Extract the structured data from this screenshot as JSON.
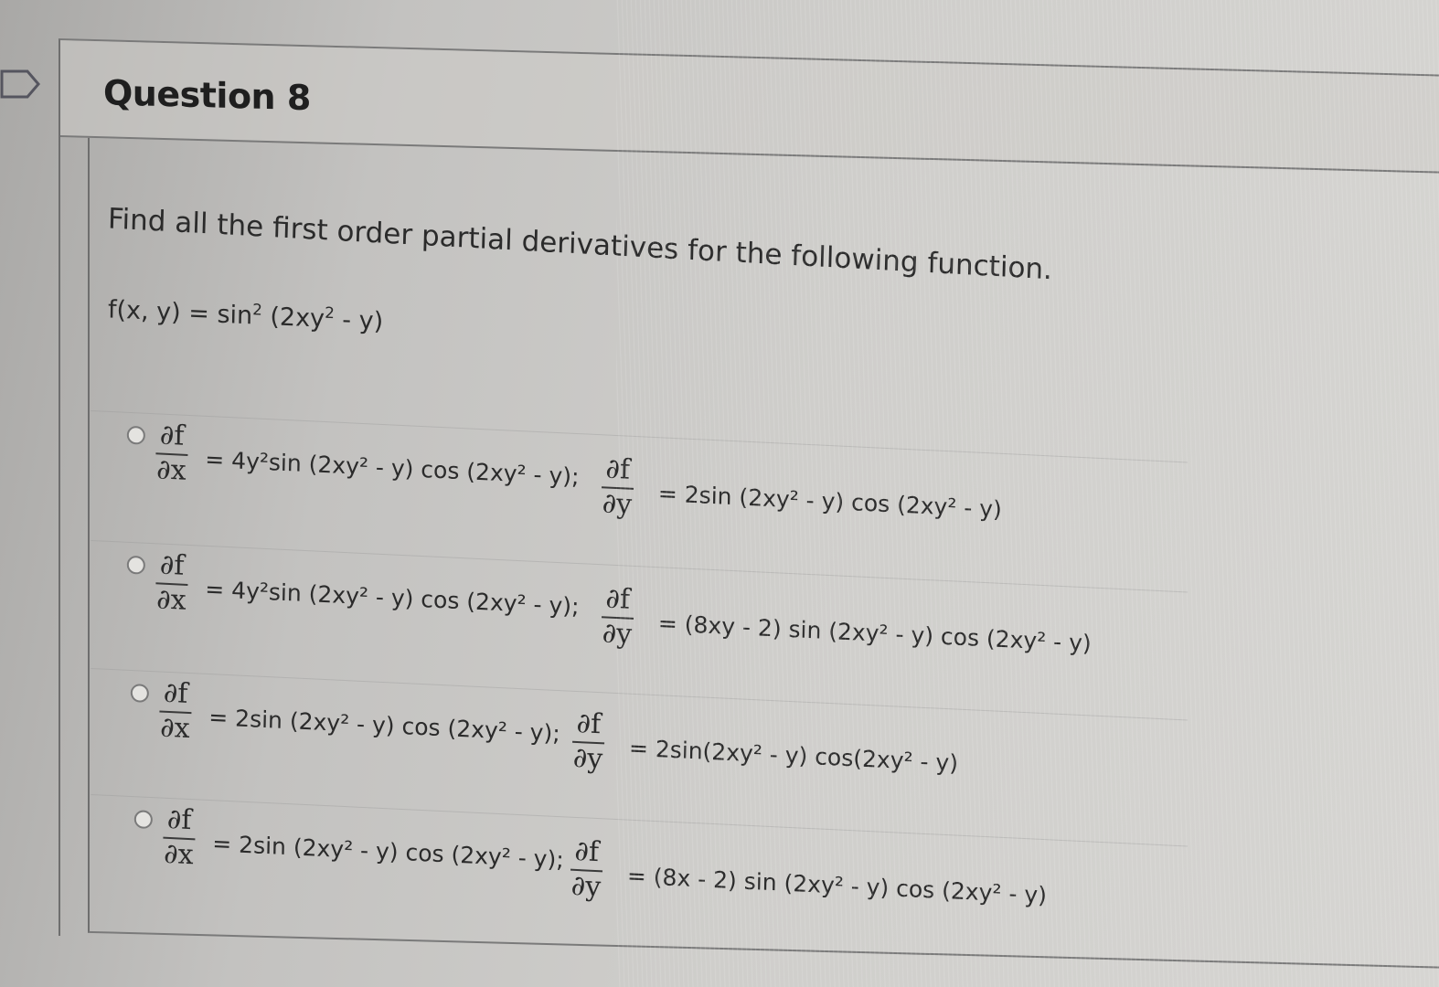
{
  "question": {
    "title": "Question 8",
    "prompt": "Find all the first order partial derivatives for the following function.",
    "function": {
      "lhs": "f(x, y) = sin",
      "power": "2",
      "arg_open": " (2xy",
      "arg_power": "2",
      "arg_close": " - y)"
    }
  },
  "symbols": {
    "df": "∂f",
    "dx": "∂x",
    "dy": "∂y"
  },
  "options": [
    {
      "selected": false,
      "dfdx": "= 4y²sin (2xy² - y) cos (2xy² - y);",
      "dfdy": "= 2sin (2xy² - y) cos (2xy² - y)"
    },
    {
      "selected": false,
      "dfdx": "= 4y²sin (2xy² - y) cos (2xy² - y);",
      "dfdy": "= (8xy - 2) sin (2xy² - y) cos (2xy² - y)"
    },
    {
      "selected": false,
      "dfdx": "= 2sin (2xy² - y) cos (2xy² - y);",
      "dfdy": "= 2sin(2xy² - y) cos(2xy² - y)"
    },
    {
      "selected": false,
      "dfdx": "= 2sin (2xy² - y) cos (2xy² - y);",
      "dfdy": "= (8x - 2) sin (2xy² - y) cos (2xy² - y)"
    }
  ]
}
